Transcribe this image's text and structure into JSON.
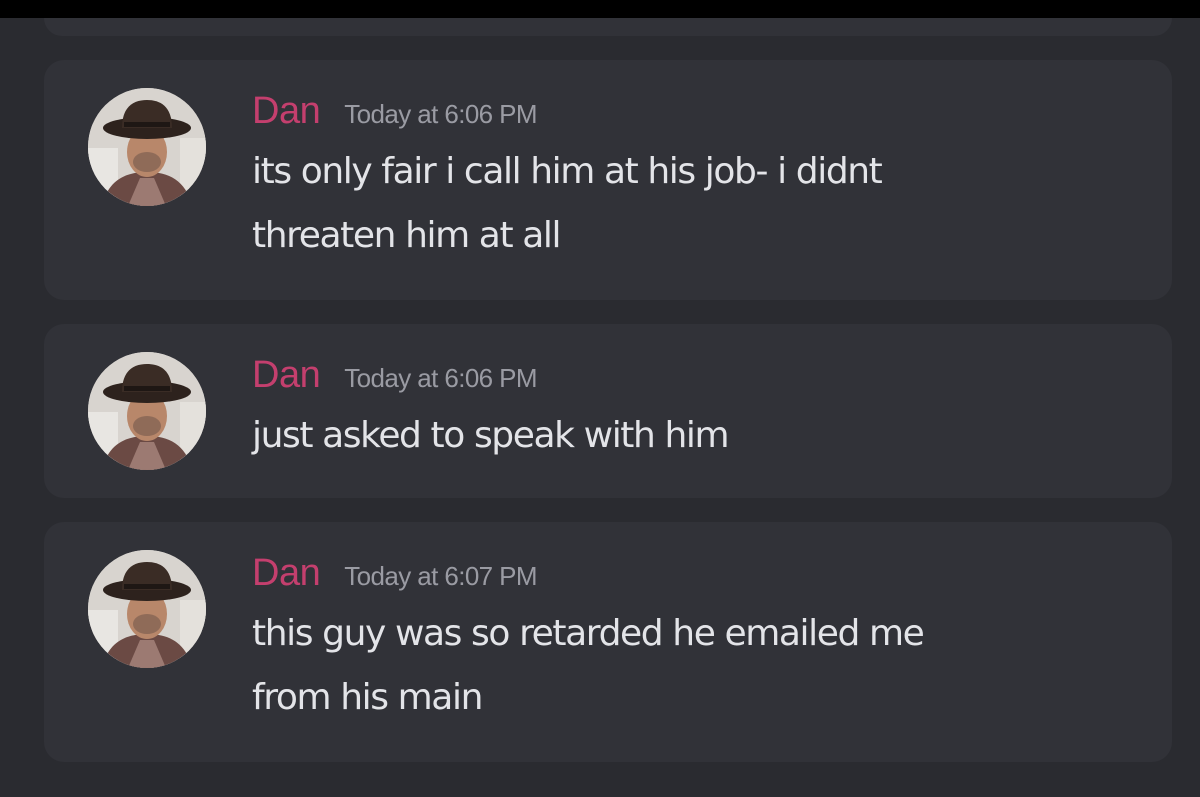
{
  "colors": {
    "background": "#2a2b30",
    "card": "#313238",
    "author": "#c43f6e",
    "timestamp": "#9a9ba3",
    "text": "#e3e4e8"
  },
  "messages": [
    {
      "author": "Dan",
      "timestamp": "Today at 6:06 PM",
      "avatar_icon": "user-avatar-cowboy-hat",
      "lines": [
        "its only fair i call him at his job- i didnt",
        "threaten him at all"
      ]
    },
    {
      "author": "Dan",
      "timestamp": "Today at 6:06 PM",
      "avatar_icon": "user-avatar-cowboy-hat",
      "lines": [
        "just asked to speak with him"
      ]
    },
    {
      "author": "Dan",
      "timestamp": "Today at 6:07 PM",
      "avatar_icon": "user-avatar-cowboy-hat",
      "lines": [
        "this guy was so retarded he emailed me",
        "from his main"
      ]
    }
  ]
}
